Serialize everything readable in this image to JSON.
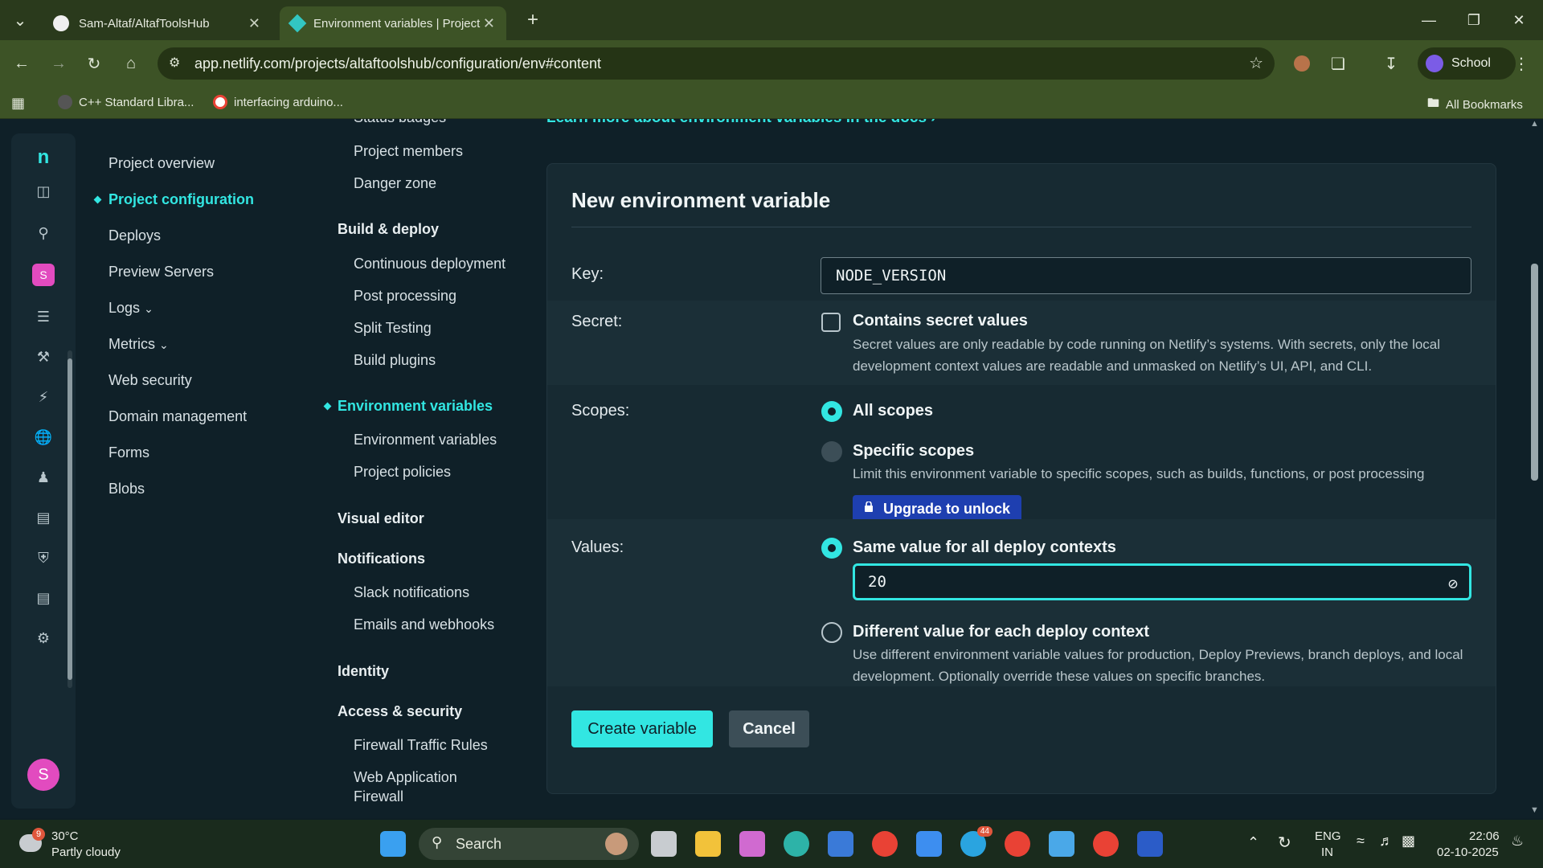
{
  "browser": {
    "tabs": [
      {
        "title": "Sam-Altaf/AltafToolsHub"
      },
      {
        "title": "Environment variables | Project"
      }
    ],
    "url": "app.netlify.com/projects/altaftoolshub/configuration/env#content",
    "profile_label": "School",
    "bookmarks": [
      "C++ Standard Libra...",
      "interfacing arduino..."
    ],
    "all_bookmarks_label": "All Bookmarks"
  },
  "sidebar": {
    "items": [
      {
        "label": "Project overview"
      },
      {
        "label": "Project configuration"
      },
      {
        "label": "Deploys"
      },
      {
        "label": "Preview Servers"
      },
      {
        "label": "Logs"
      },
      {
        "label": "Metrics"
      },
      {
        "label": "Web security"
      },
      {
        "label": "Domain management"
      },
      {
        "label": "Forms"
      },
      {
        "label": "Blobs"
      }
    ],
    "avatar_letter": "S"
  },
  "subnav": {
    "partial_top": "Status badges",
    "project_members": "Project members",
    "danger_zone": "Danger zone",
    "build_deploy": "Build & deploy",
    "continuous_deployment": "Continuous deployment",
    "post_processing": "Post processing",
    "split_testing": "Split Testing",
    "build_plugins": "Build plugins",
    "environment_variables_active": "Environment variables",
    "environment_variables": "Environment variables",
    "project_policies": "Project policies",
    "visual_editor": "Visual editor",
    "notifications": "Notifications",
    "slack_notifications": "Slack notifications",
    "emails_webhooks": "Emails and webhooks",
    "identity": "Identity",
    "access_security": "Access & security",
    "firewall_rules": "Firewall Traffic Rules",
    "waf_line1": "Web Application",
    "waf_line2": "Firewall"
  },
  "main": {
    "learn_link": "Learn more about environment variables in the docs ›",
    "card_title": "New environment variable",
    "key_label": "Key:",
    "key_value": "NODE_VERSION",
    "secret_label": "Secret:",
    "secret_title": "Contains secret values",
    "secret_desc": "Secret values are only readable by code running on Netlify’s systems. With secrets, only the local development context values are readable and unmasked on Netlify’s UI, API, and CLI.",
    "scopes_label": "Scopes:",
    "all_scopes": "All scopes",
    "specific_scopes": "Specific scopes",
    "specific_desc": "Limit this environment variable to specific scopes, such as builds, functions, or post processing",
    "upgrade_label": "Upgrade to unlock",
    "values_label": "Values:",
    "same_value": "Same value for all deploy contexts",
    "value": "20",
    "different_value": "Different value for each deploy context",
    "different_desc": "Use different environment variable values for production, Deploy Previews, branch deploys, and local development. Optionally override these values on specific branches.",
    "create_label": "Create variable",
    "cancel_label": "Cancel"
  },
  "taskbar": {
    "temperature": "30°C",
    "weather": "Partly cloudy",
    "weather_badge": "9",
    "search_label": "Search",
    "lang_top": "ENG",
    "lang_bottom": "IN",
    "time": "22:06",
    "date": "02-10-2025",
    "telegram_badge": "44"
  },
  "colors": {
    "accent": "#32e6e2",
    "upgrade": "#1e3fb0",
    "page_bg": "#0f2028",
    "card_bg": "#172a32",
    "chrome": "#3d5326"
  }
}
